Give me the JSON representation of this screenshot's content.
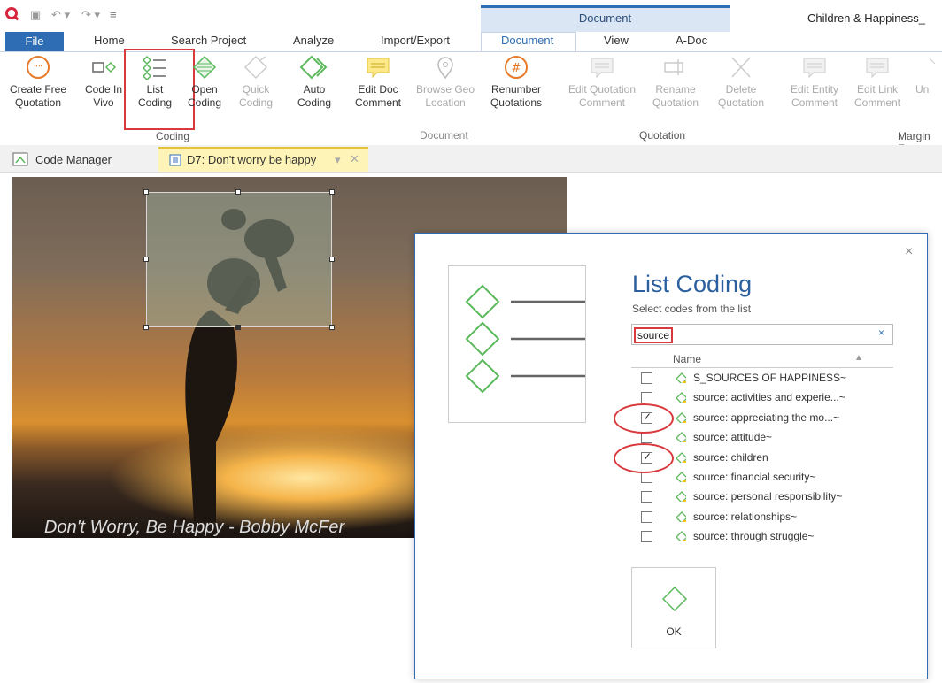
{
  "window": {
    "contextual_group": "Document",
    "doc_title": "Children & Happiness_"
  },
  "tabs": {
    "file": "File",
    "home": "Home",
    "search": "Search Project",
    "analyze": "Analyze",
    "import_export": "Import/Export",
    "document": "Document",
    "view": "View",
    "adoc": "A-Doc"
  },
  "ribbon": {
    "create_free_quotation": [
      "Create Free",
      "Quotation"
    ],
    "code_in_vivo": [
      "Code In",
      "Vivo"
    ],
    "list_coding": [
      "List",
      "Coding"
    ],
    "open_coding": [
      "Open",
      "Coding"
    ],
    "quick_coding": [
      "Quick",
      "Coding"
    ],
    "auto_coding": [
      "Auto",
      "Coding"
    ],
    "coding_group": "Coding",
    "edit_doc_comment": [
      "Edit Doc",
      "Comment"
    ],
    "browse_geo_location": [
      "Browse Geo",
      "Location"
    ],
    "renumber_quotations": [
      "Renumber",
      "Quotations"
    ],
    "document_group": "Document",
    "edit_quotation_comment": [
      "Edit Quotation",
      "Comment"
    ],
    "rename_quotation": [
      "Rename",
      "Quotation"
    ],
    "delete_quotation": [
      "Delete",
      "Quotation"
    ],
    "quotation_group": "Quotation",
    "edit_entity_comment": [
      "Edit Entity",
      "Comment"
    ],
    "edit_link_comment": [
      "Edit Link",
      "Comment"
    ],
    "un": "Un",
    "margin_group": "Margin Er"
  },
  "doc_tabs": {
    "code_manager": "Code Manager",
    "document": "D7: Don't worry be happy"
  },
  "image": {
    "caption": "Don't Worry, Be Happy - Bobby McFer"
  },
  "dialog": {
    "title": "List Coding",
    "subtitle": "Select codes from the list",
    "search_value": "source",
    "clear": "×",
    "column_name": "Name",
    "close": "×",
    "ok": "OK",
    "codes": [
      {
        "label": "S_SOURCES OF HAPPINESS~",
        "checked": false
      },
      {
        "label": "source: activities and experie...~",
        "checked": false
      },
      {
        "label": "source: appreciating the mo...~",
        "checked": true
      },
      {
        "label": "source: attitude~",
        "checked": false
      },
      {
        "label": "source: children",
        "checked": true
      },
      {
        "label": "source: financial security~",
        "checked": false
      },
      {
        "label": "source: personal responsibility~",
        "checked": false
      },
      {
        "label": "source: relationships~",
        "checked": false
      },
      {
        "label": "source: through struggle~",
        "checked": false
      }
    ]
  },
  "colors": {
    "accent": "#2e6db4",
    "highlight_red": "#d9393d",
    "code_green": "#5cb85c",
    "active_tab_yellow": "#fff4b8"
  }
}
